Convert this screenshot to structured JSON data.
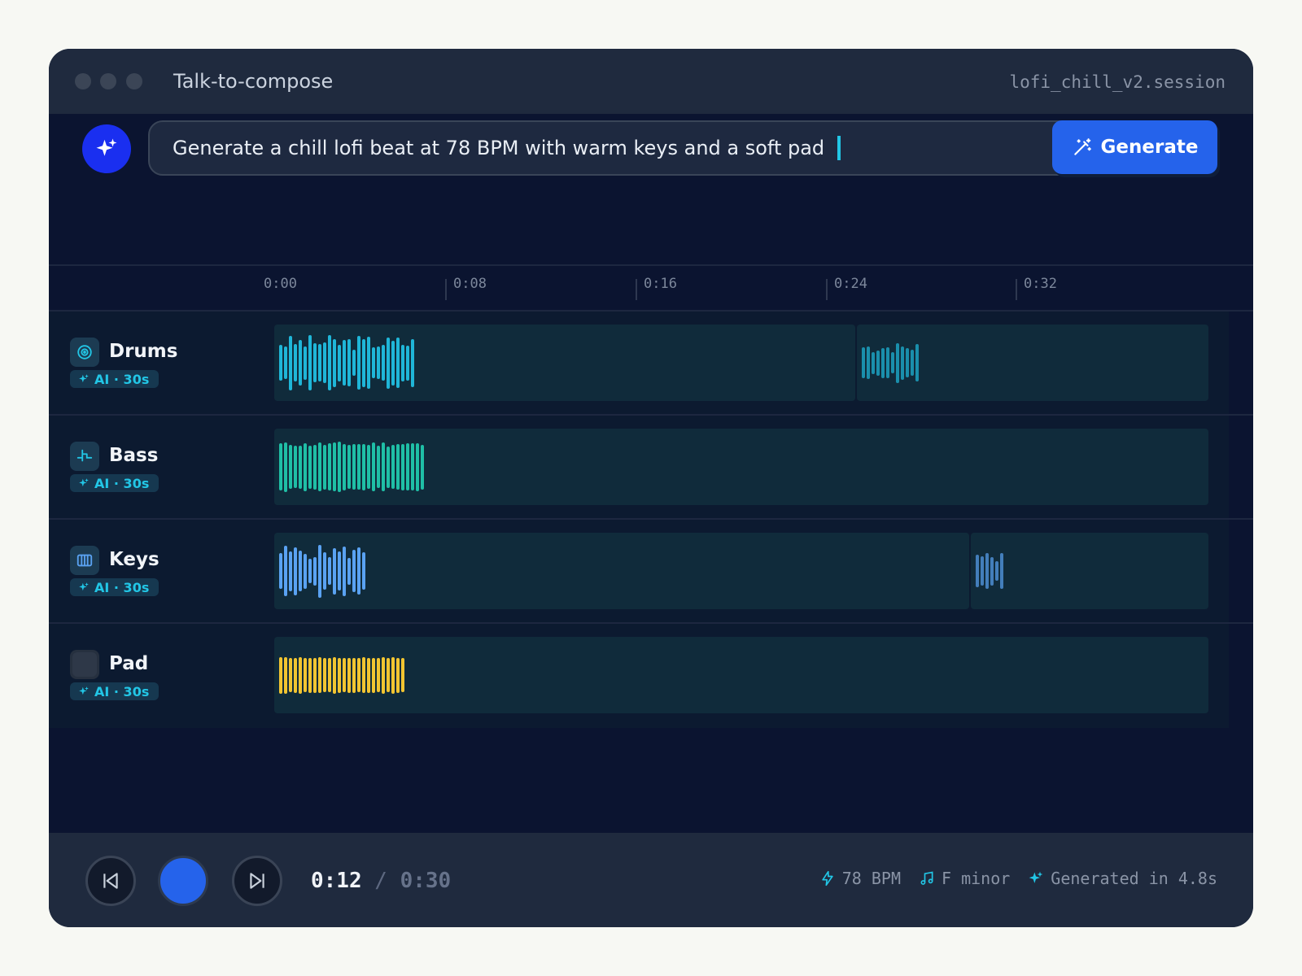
{
  "window": {
    "title": "Talk-to-compose",
    "session_name": "lofi_chill_v2.session"
  },
  "prompt": {
    "value": "Generate a chill lofi beat at 78 BPM with warm keys and a soft pad",
    "generate_label": "Generate"
  },
  "ruler": {
    "ticks": [
      "0:00",
      "0:08",
      "0:16",
      "0:24",
      "0:32"
    ]
  },
  "tracks": [
    {
      "name": "Drums",
      "badge": "AI · 30s",
      "icon": "vinyl-icon",
      "color": "#1fb6d8"
    },
    {
      "name": "Bass",
      "badge": "AI · 30s",
      "icon": "waveform-icon",
      "color": "#1fbfa6"
    },
    {
      "name": "Keys",
      "badge": "AI · 30s",
      "icon": "piano-icon",
      "color": "#5aa2f2"
    },
    {
      "name": "Pad",
      "badge": "AI · 30s",
      "icon": "pad-icon",
      "color": "#f2c531"
    }
  ],
  "transport": {
    "current_time": "0:12",
    "separator": "/",
    "total_time": "0:30",
    "bpm": "78 BPM",
    "key": "F minor",
    "generated": "Generated in 4.8s"
  },
  "colors": {
    "accent": "#2563eb",
    "cyan": "#22c6e6"
  }
}
